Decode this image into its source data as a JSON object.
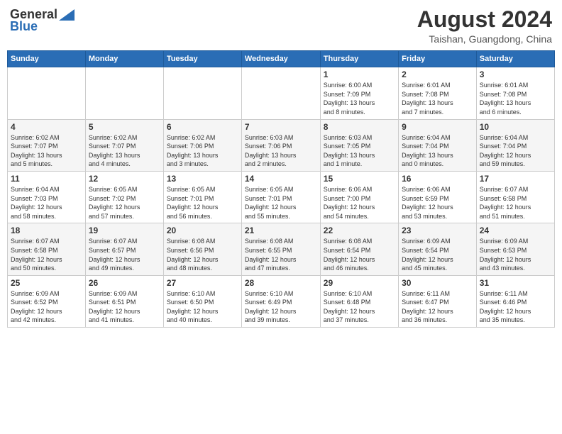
{
  "header": {
    "logo_general": "General",
    "logo_blue": "Blue",
    "month_year": "August 2024",
    "location": "Taishan, Guangdong, China"
  },
  "weekdays": [
    "Sunday",
    "Monday",
    "Tuesday",
    "Wednesday",
    "Thursday",
    "Friday",
    "Saturday"
  ],
  "weeks": [
    [
      {
        "day": "",
        "info": ""
      },
      {
        "day": "",
        "info": ""
      },
      {
        "day": "",
        "info": ""
      },
      {
        "day": "",
        "info": ""
      },
      {
        "day": "1",
        "info": "Sunrise: 6:00 AM\nSunset: 7:09 PM\nDaylight: 13 hours\nand 8 minutes."
      },
      {
        "day": "2",
        "info": "Sunrise: 6:01 AM\nSunset: 7:08 PM\nDaylight: 13 hours\nand 7 minutes."
      },
      {
        "day": "3",
        "info": "Sunrise: 6:01 AM\nSunset: 7:08 PM\nDaylight: 13 hours\nand 6 minutes."
      }
    ],
    [
      {
        "day": "4",
        "info": "Sunrise: 6:02 AM\nSunset: 7:07 PM\nDaylight: 13 hours\nand 5 minutes."
      },
      {
        "day": "5",
        "info": "Sunrise: 6:02 AM\nSunset: 7:07 PM\nDaylight: 13 hours\nand 4 minutes."
      },
      {
        "day": "6",
        "info": "Sunrise: 6:02 AM\nSunset: 7:06 PM\nDaylight: 13 hours\nand 3 minutes."
      },
      {
        "day": "7",
        "info": "Sunrise: 6:03 AM\nSunset: 7:06 PM\nDaylight: 13 hours\nand 2 minutes."
      },
      {
        "day": "8",
        "info": "Sunrise: 6:03 AM\nSunset: 7:05 PM\nDaylight: 13 hours\nand 1 minute."
      },
      {
        "day": "9",
        "info": "Sunrise: 6:04 AM\nSunset: 7:04 PM\nDaylight: 13 hours\nand 0 minutes."
      },
      {
        "day": "10",
        "info": "Sunrise: 6:04 AM\nSunset: 7:04 PM\nDaylight: 12 hours\nand 59 minutes."
      }
    ],
    [
      {
        "day": "11",
        "info": "Sunrise: 6:04 AM\nSunset: 7:03 PM\nDaylight: 12 hours\nand 58 minutes."
      },
      {
        "day": "12",
        "info": "Sunrise: 6:05 AM\nSunset: 7:02 PM\nDaylight: 12 hours\nand 57 minutes."
      },
      {
        "day": "13",
        "info": "Sunrise: 6:05 AM\nSunset: 7:01 PM\nDaylight: 12 hours\nand 56 minutes."
      },
      {
        "day": "14",
        "info": "Sunrise: 6:05 AM\nSunset: 7:01 PM\nDaylight: 12 hours\nand 55 minutes."
      },
      {
        "day": "15",
        "info": "Sunrise: 6:06 AM\nSunset: 7:00 PM\nDaylight: 12 hours\nand 54 minutes."
      },
      {
        "day": "16",
        "info": "Sunrise: 6:06 AM\nSunset: 6:59 PM\nDaylight: 12 hours\nand 53 minutes."
      },
      {
        "day": "17",
        "info": "Sunrise: 6:07 AM\nSunset: 6:58 PM\nDaylight: 12 hours\nand 51 minutes."
      }
    ],
    [
      {
        "day": "18",
        "info": "Sunrise: 6:07 AM\nSunset: 6:58 PM\nDaylight: 12 hours\nand 50 minutes."
      },
      {
        "day": "19",
        "info": "Sunrise: 6:07 AM\nSunset: 6:57 PM\nDaylight: 12 hours\nand 49 minutes."
      },
      {
        "day": "20",
        "info": "Sunrise: 6:08 AM\nSunset: 6:56 PM\nDaylight: 12 hours\nand 48 minutes."
      },
      {
        "day": "21",
        "info": "Sunrise: 6:08 AM\nSunset: 6:55 PM\nDaylight: 12 hours\nand 47 minutes."
      },
      {
        "day": "22",
        "info": "Sunrise: 6:08 AM\nSunset: 6:54 PM\nDaylight: 12 hours\nand 46 minutes."
      },
      {
        "day": "23",
        "info": "Sunrise: 6:09 AM\nSunset: 6:54 PM\nDaylight: 12 hours\nand 45 minutes."
      },
      {
        "day": "24",
        "info": "Sunrise: 6:09 AM\nSunset: 6:53 PM\nDaylight: 12 hours\nand 43 minutes."
      }
    ],
    [
      {
        "day": "25",
        "info": "Sunrise: 6:09 AM\nSunset: 6:52 PM\nDaylight: 12 hours\nand 42 minutes."
      },
      {
        "day": "26",
        "info": "Sunrise: 6:09 AM\nSunset: 6:51 PM\nDaylight: 12 hours\nand 41 minutes."
      },
      {
        "day": "27",
        "info": "Sunrise: 6:10 AM\nSunset: 6:50 PM\nDaylight: 12 hours\nand 40 minutes."
      },
      {
        "day": "28",
        "info": "Sunrise: 6:10 AM\nSunset: 6:49 PM\nDaylight: 12 hours\nand 39 minutes."
      },
      {
        "day": "29",
        "info": "Sunrise: 6:10 AM\nSunset: 6:48 PM\nDaylight: 12 hours\nand 37 minutes."
      },
      {
        "day": "30",
        "info": "Sunrise: 6:11 AM\nSunset: 6:47 PM\nDaylight: 12 hours\nand 36 minutes."
      },
      {
        "day": "31",
        "info": "Sunrise: 6:11 AM\nSunset: 6:46 PM\nDaylight: 12 hours\nand 35 minutes."
      }
    ]
  ]
}
